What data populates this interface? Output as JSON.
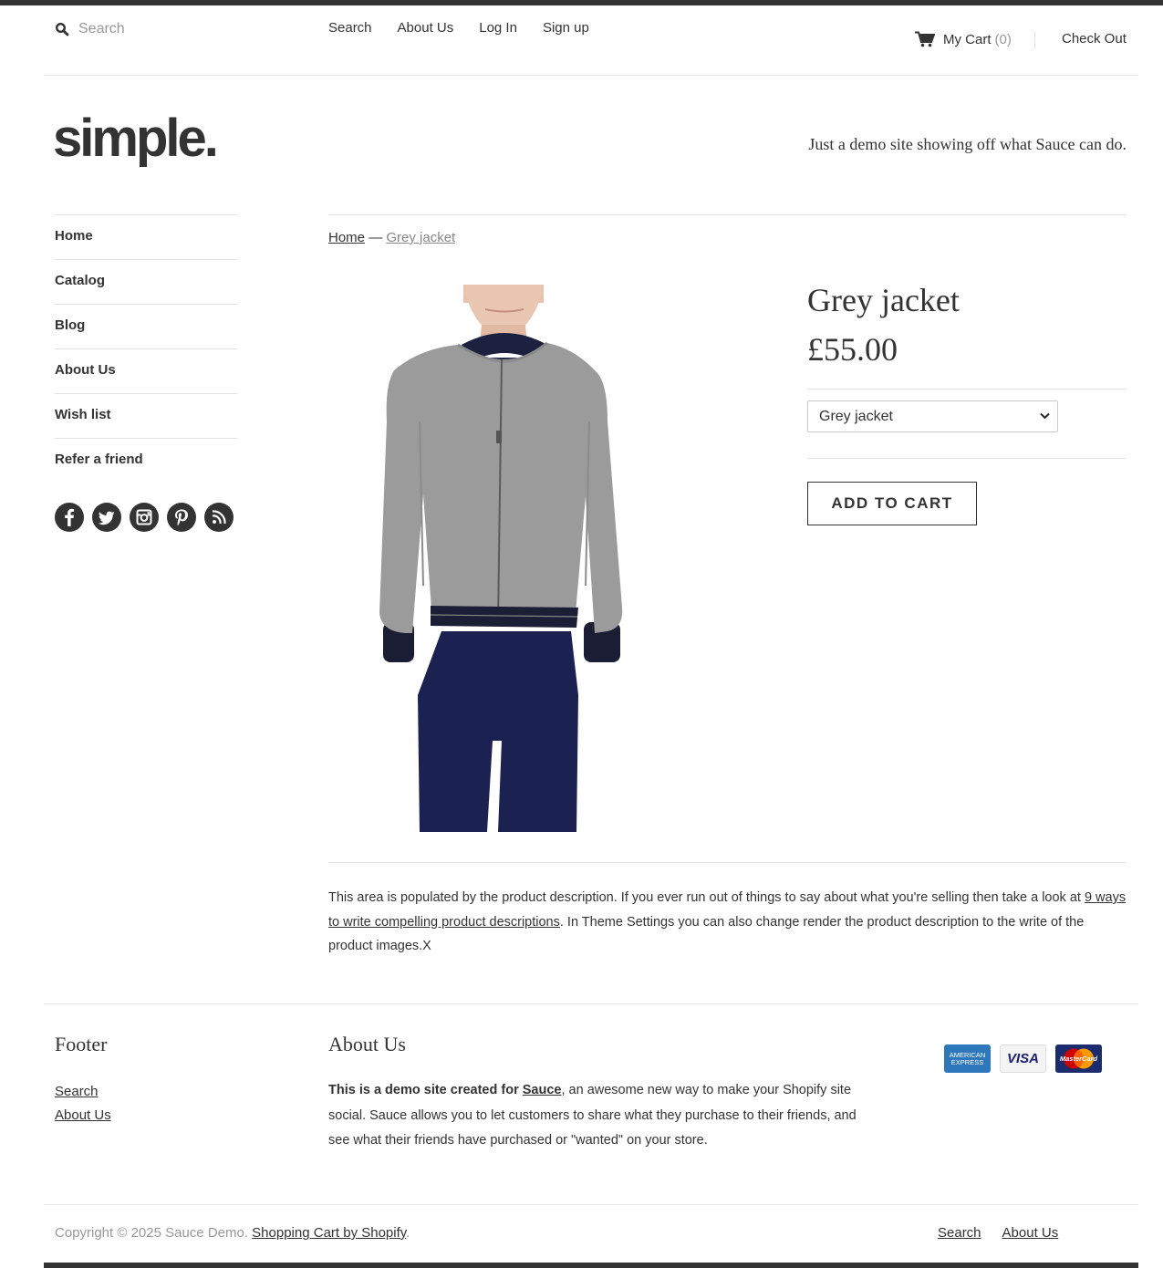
{
  "header": {
    "search_placeholder": "Search",
    "nav": [
      "Search",
      "About Us",
      "Log In",
      "Sign up"
    ],
    "cart_label": "My Cart",
    "cart_count": "(0)",
    "checkout_label": "Check Out"
  },
  "brand": {
    "logo": "simple.",
    "tagline": "Just a demo site showing off what Sauce can do."
  },
  "sidebar": {
    "items": [
      "Home",
      "Catalog",
      "Blog",
      "About Us",
      "Wish list",
      "Refer a friend"
    ],
    "social": [
      "facebook-icon",
      "twitter-icon",
      "instagram-icon",
      "pinterest-icon",
      "rss-icon"
    ]
  },
  "breadcrumb": {
    "home": "Home",
    "separator": "—",
    "current": "Grey jacket"
  },
  "product": {
    "title": "Grey jacket",
    "price": "£55.00",
    "variant_selected": "Grey jacket",
    "add_to_cart": "ADD TO CART",
    "description_before": "This area is populated by the product description. If you ever run out of things to say about what you're selling then take a look at ",
    "description_link": "9 ways to write compelling product descriptions",
    "description_after": ". In Theme Settings you can also change render the product description to the write of the product images.X"
  },
  "footer": {
    "col1_title": "Footer",
    "col1_links": [
      "Search",
      "About Us"
    ],
    "col2_title": "About Us",
    "about_bold": "This is a demo site created for ",
    "about_link": "Sauce",
    "about_rest": ", an awesome new way to make your Shopify site social. Sauce allows you to let customers to share what they purchase to their friends, and see what their friends have purchased or \"wanted\" on your store.",
    "cards": [
      "AMERICAN EXPRESS",
      "VISA",
      "MasterCard"
    ],
    "copyright": "Copyright © 2025 Sauce Demo.",
    "shopify_link": "Shopping Cart by Shopify",
    "copyright_end": ".",
    "bottom_links": [
      "Search",
      "About Us"
    ]
  },
  "colors": {
    "text": "#333333",
    "muted": "#999999",
    "border": "#e3e3e3",
    "amex": "#2e77bb",
    "visa": "#1a1f71",
    "mastercard": "#cc0000"
  }
}
